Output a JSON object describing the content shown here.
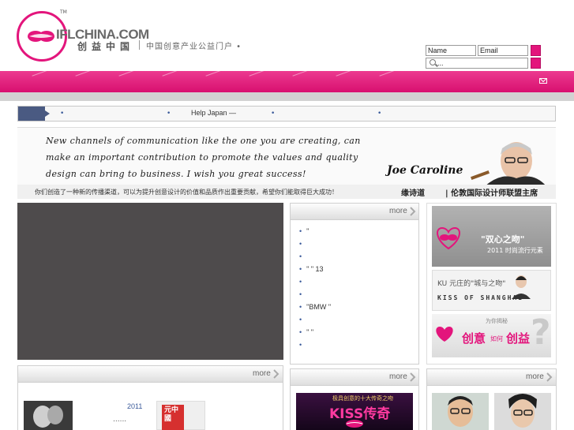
{
  "brand": {
    "tm": "TM",
    "name": "IFLCHINA.COM",
    "chinese_name": "创益中国",
    "tagline": "中国创意产业公益门户 •"
  },
  "form": {
    "name_placeholder": "Name",
    "email_placeholder": "Email",
    "search_value": "..."
  },
  "ticker": {
    "bullets": [
      "•",
      "•",
      "•",
      "•"
    ],
    "headline": "Help Japan —"
  },
  "banner": {
    "line1": "New channels of communication like the one you are creating, can",
    "line2": "make an important contribution to promote the values and quality",
    "line3": "design can bring to business. I wish you great success!",
    "signature": "Joe Caroline",
    "quote_cn": "你们创造了一种新的传播渠道，可以为提升创意设计的价值和品质作出重要贡献，希望你们能取得巨大成功！",
    "person_cn": "缘诗道",
    "role_cn": "| 伦敦国际设计师联盟主席"
  },
  "panels": {
    "more_label": "more"
  },
  "news_list": [
    {
      "bullet": "•",
      "text": "\""
    },
    {
      "bullet": "•",
      "text": ""
    },
    {
      "bullet": "•",
      "text": ""
    },
    {
      "bullet": "•",
      "text": "\"  \"  13"
    },
    {
      "bullet": "•",
      "text": ""
    },
    {
      "bullet": "•",
      "text": ""
    },
    {
      "bullet": "•",
      "text": "\"BMW  \""
    },
    {
      "bullet": "•",
      "text": ""
    },
    {
      "bullet": "•",
      "text": "\"  \""
    },
    {
      "bullet": "•",
      "text": ""
    }
  ],
  "promos": {
    "p1_title": "\"双心之吻\"",
    "p1_sub": "2011 时尚流行元素",
    "p2_title": "KU 元庄的\"城与之吻\"",
    "p2_sub": "KISS OF SHANGHAI",
    "p3_small": "为你揭秘",
    "p3_main": "创意",
    "p3_mid": "如何",
    "p3_end": "创益"
  },
  "bottom": {
    "year": "2011",
    "dots1": "......",
    "dots2": "......",
    "seal_text": "元中國",
    "kiss_small": "极具创意的十大传奇之吻",
    "kiss_big": "KISS传奇"
  }
}
